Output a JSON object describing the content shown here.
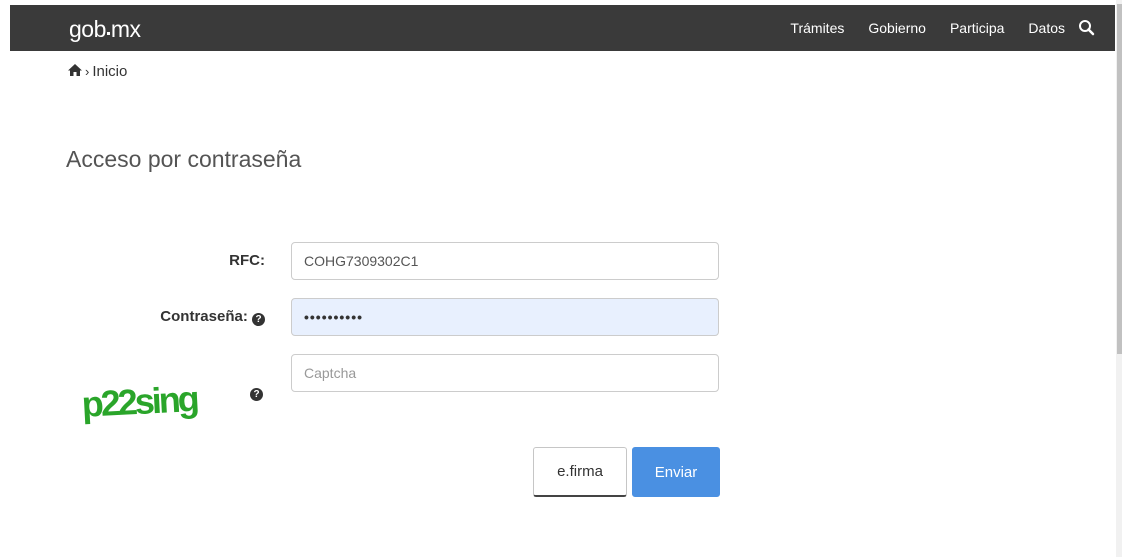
{
  "header": {
    "brand": "gob",
    "brand_suffix": "mx",
    "nav": [
      "Trámites",
      "Gobierno",
      "Participa",
      "Datos"
    ],
    "search_icon": "search-icon"
  },
  "breadcrumb": {
    "home_icon": "home-icon",
    "separator": "›",
    "current": "Inicio"
  },
  "main": {
    "title": "Acceso por contraseña"
  },
  "form": {
    "rfc_label": "RFC:",
    "rfc_value": "COHG7309302C1",
    "password_label": "Contraseña:",
    "password_value": "••••••••••",
    "captcha_placeholder": "Captcha",
    "captcha_image_text": "p22sing",
    "efirma_label": "e.firma",
    "submit_label": "Enviar"
  },
  "colors": {
    "navbar": "#3a3a3a",
    "primary": "#4a90e2",
    "captcha_green": "#2aa52a",
    "password_fill": "#e8f0fe"
  }
}
